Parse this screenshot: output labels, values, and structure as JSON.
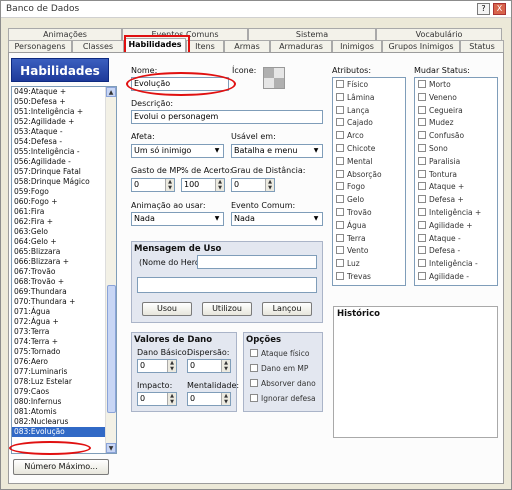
{
  "window": {
    "title": "Banco de Dados",
    "help": "?",
    "close": "X"
  },
  "tabs_row1": [
    "Animações",
    "Eventos Comuns",
    "Sistema",
    "Vocabulário"
  ],
  "tabs_row2": [
    "Personagens",
    "Classes",
    "Habilidades",
    "Itens",
    "Armas",
    "Armaduras",
    "Inimigos",
    "Grupos Inimigos",
    "Status"
  ],
  "left": {
    "header": "Habilidades",
    "items": [
      "049:Ataque +",
      "050:Defesa +",
      "051:Inteligência +",
      "052:Agilidade +",
      "053:Ataque -",
      "054:Defesa -",
      "055:Inteligência -",
      "056:Agilidade -",
      "057:Drinque Fatal",
      "058:Drinque Mágico",
      "059:Fogo",
      "060:Fogo +",
      "061:Fira",
      "062:Fira +",
      "063:Gelo",
      "064:Gelo +",
      "065:Blizzara",
      "066:Blizzara +",
      "067:Trovão",
      "068:Trovão +",
      "069:Thundara",
      "070:Thundara +",
      "071:Água",
      "072:Água +",
      "073:Terra",
      "074:Terra +",
      "075:Tornado",
      "076:Aero",
      "077:Luminaris",
      "078:Luz Estelar",
      "079:Caos",
      "080:Infernus",
      "081:Atomis",
      "082:Nuclearus",
      "083:Evolução"
    ],
    "selected": "083:Evolução",
    "max_button": "Número Máximo..."
  },
  "form": {
    "name_label": "Nome:",
    "name_value": "Evolução",
    "icon_label": "Ícone:",
    "desc_label": "Descrição:",
    "desc_value": "Evolui o personagem",
    "scope_label": "Afeta:",
    "scope_value": "Um só inimigo",
    "occasion_label": "Usável em:",
    "occasion_value": "Batalha e menu",
    "mp_label": "Gasto de MP:",
    "mp_value": "0",
    "hit_label": "% de Acerto:",
    "hit_value": "100",
    "var_label": "Grau de Distância:",
    "var_value": "0",
    "anim_label": "Animação ao usar:",
    "anim_value": "Nada",
    "event_label": "Evento Comum:",
    "event_value": "Nada"
  },
  "message": {
    "title": "Mensagem de Uso",
    "hero_label": "(Nome do Herói)",
    "btn_used": "Usou",
    "btn_utilized": "Utilizou",
    "btn_cast": "Lançou"
  },
  "damage": {
    "title": "Valores de Dano",
    "base_label": "Dano Básico:",
    "base_value": "0",
    "dispersion_label": "Dispersão:",
    "dispersion_value": "0",
    "impact_label": "Impacto:",
    "impact_value": "0",
    "mentality_label": "Mentalidade:",
    "mentality_value": "0"
  },
  "options": {
    "title": "Opções",
    "items": [
      "Ataque físico",
      "Dano em MP",
      "Absorver dano",
      "Ignorar defesa"
    ]
  },
  "attributes": {
    "label": "Atributos:",
    "items": [
      "Físico",
      "Lâmina",
      "Lança",
      "Cajado",
      "Arco",
      "Chicote",
      "Mental",
      "Absorção",
      "Fogo",
      "Gelo",
      "Trovão",
      "Água",
      "Terra",
      "Vento",
      "Luz",
      "Trevas"
    ]
  },
  "status_change": {
    "label": "Mudar Status:",
    "items": [
      "Morto",
      "Veneno",
      "Cegueira",
      "Mudez",
      "Confusão",
      "Sono",
      "Paralisia",
      "Tontura",
      "Ataque +",
      "Defesa +",
      "Inteligência +",
      "Agilidade +",
      "Ataque -",
      "Defesa -",
      "Inteligência -",
      "Agilidade -"
    ]
  },
  "history": {
    "title": "Histórico"
  },
  "colors": {
    "highlight_red": "#e01010",
    "selection_blue": "#3169c6",
    "header_blue": "#1e3a9a"
  }
}
